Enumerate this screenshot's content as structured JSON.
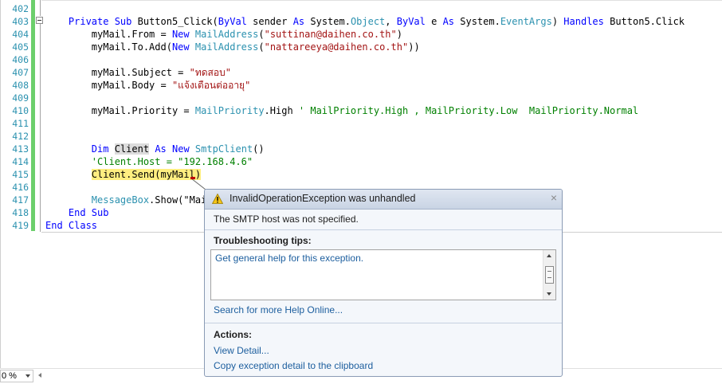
{
  "editor": {
    "line_numbers": [
      "402",
      "403",
      "404",
      "405",
      "406",
      "407",
      "408",
      "409",
      "410",
      "411",
      "412",
      "413",
      "414",
      "415",
      "416",
      "417",
      "418",
      "419"
    ],
    "code": {
      "l403": {
        "indent": "    ",
        "kw1": "Private Sub",
        "name": " Button5_Click(",
        "byval1": "ByVal",
        "p1": " sender ",
        "as1": "As",
        "p2": " System.",
        "obj": "Object",
        "p3": ", ",
        "byval2": "ByVal",
        "p4": " e ",
        "as2": "As",
        "p5": " System.",
        "evt": "EventArgs",
        "p6": ") ",
        "handles": "Handles",
        "p7": " Button5.Click"
      },
      "l404": {
        "indent": "        ",
        "p1": "myMail.From = ",
        "new": "New",
        "sp": " ",
        "ty": "MailAddress",
        "p2": "(",
        "str": "\"suttinan@daihen.co.th\"",
        "p3": ")"
      },
      "l405": {
        "indent": "        ",
        "p1": "myMail.To.Add(",
        "new": "New",
        "sp": " ",
        "ty": "MailAddress",
        "p2": "(",
        "str": "\"nattareeya@daihen.co.th\"",
        "p3": "))"
      },
      "l407": {
        "indent": "        ",
        "p1": "myMail.Subject = ",
        "str": "\"ทดสอบ\""
      },
      "l408": {
        "indent": "        ",
        "p1": "myMail.Body = ",
        "str": "\"แจ้งเตือนต่ออายุ\""
      },
      "l410": {
        "indent": "        ",
        "p1": "myMail.Priority = ",
        "ty": "MailPriority",
        "p2": ".High ",
        "cm": "' MailPriority.High , MailPriority.Low  MailPriority.Normal"
      },
      "l413": {
        "indent": "        ",
        "dim": "Dim",
        "p1": " ",
        "client": "Client",
        "p2": " ",
        "as": "As",
        "p3": " ",
        "new": "New",
        "p4": " ",
        "ty": "SmtpClient",
        "p5": "()"
      },
      "l414": {
        "indent": "        ",
        "cm": "'Client.Host = \"192.168.4.6\""
      },
      "l415": {
        "indent": "        ",
        "hl": "Client.Send(myMail)"
      },
      "l417": {
        "indent": "        ",
        "ty": "MessageBox",
        "p1": ".Show(\"Mai"
      },
      "l418": {
        "indent": "    ",
        "kw": "End Sub"
      },
      "l419": {
        "kw": "End Class"
      }
    }
  },
  "statusbar": {
    "zoom": "0 %"
  },
  "exception_popup": {
    "title": "InvalidOperationException was unhandled",
    "message": "The SMTP host was not specified.",
    "tips_heading": "Troubleshooting tips:",
    "tip_link": "Get general help for this exception.",
    "search_link": "Search for more Help Online...",
    "actions_heading": "Actions:",
    "action_view": "View Detail...",
    "action_copy": "Copy exception detail to the clipboard",
    "close_glyph": "×"
  },
  "colors": {
    "keyword": "#0000ff",
    "type": "#2b91af",
    "string": "#a31515",
    "comment": "#008000",
    "link": "#1c5e9e",
    "change_bar": "#6ccf6c"
  },
  "icons": [
    "warning-icon",
    "close-icon",
    "collapse-icon",
    "scroll-up-icon",
    "scroll-down-icon",
    "dropdown-arrow-icon",
    "scroll-left-icon"
  ]
}
